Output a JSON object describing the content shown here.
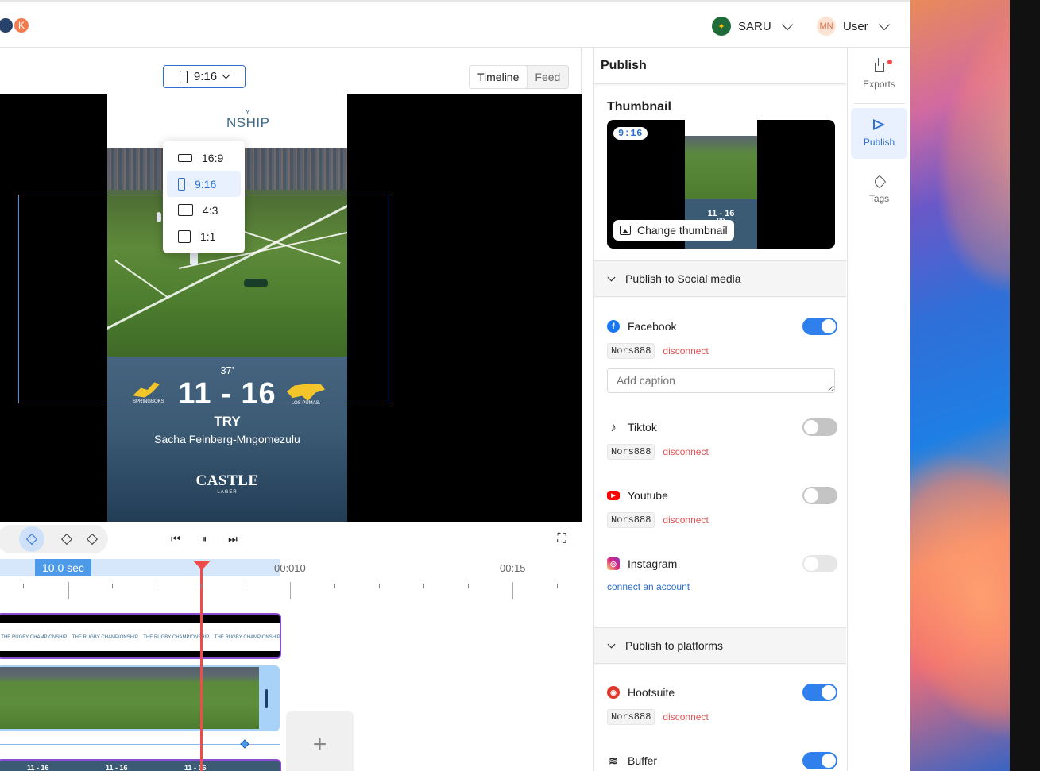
{
  "topbar": {
    "avatars": [
      "",
      "K"
    ],
    "org": {
      "name": "SARU"
    },
    "user": {
      "initials": "MN",
      "name": "User"
    }
  },
  "editor": {
    "ratio_button": {
      "label": "9:16"
    },
    "view_tabs": [
      "Timeline",
      "Feed"
    ],
    "active_view": "Timeline",
    "ratio_menu": [
      {
        "label": "16:9"
      },
      {
        "label": "9:16",
        "selected": true
      },
      {
        "label": "4:3"
      },
      {
        "label": "1:1"
      }
    ],
    "video": {
      "minute": "37’",
      "score": "11 - 16",
      "event": "TRY",
      "player": "Sacha Feinberg-Mngomezulu",
      "sponsor": "CASTLE",
      "sponsor_sub": "LAGER",
      "team_left": "SPRINGBOKS",
      "team_right": "LOS PUMAS.",
      "header_title": "NSHIP",
      "header_small": "Y"
    }
  },
  "timeline": {
    "duration_label": "10.0 sec",
    "tick_labels": [
      "00:010",
      "00:15"
    ],
    "track1_labels": [
      "THE RUGBY CHAMPIONSHIP",
      "THE RUGBY CHAMPIONSHIP",
      "THE RUGBY CHAMPIONSHIP",
      "THE RUGBY CHAMPIONSHIP"
    ],
    "track3_labels": [
      "11 - 16",
      "11 - 16",
      "11 - 16"
    ],
    "add_label": "+"
  },
  "publish": {
    "title": "Publish",
    "thumbnail": {
      "title": "Thumbnail",
      "ratio": "9:16",
      "change_label": "Change thumbnail",
      "mini_score": "11 - 16",
      "mini_event": "TRY"
    },
    "social_section": "Publish to Social media",
    "platforms_section": "Publish to platforms",
    "caption_placeholder": "Add caption",
    "disconnect_label": "disconnect",
    "connect_label": "connect an account",
    "social": [
      {
        "name": "Facebook",
        "account": "Nors888",
        "enabled": true,
        "color": "#1877f2"
      },
      {
        "name": "Tiktok",
        "account": "Nors888",
        "enabled": false,
        "color": "#000000"
      },
      {
        "name": "Youtube",
        "account": "Nors888",
        "enabled": false,
        "color": "#ff0000"
      },
      {
        "name": "Instagram",
        "account": "",
        "enabled": false,
        "color": "#d62976"
      }
    ],
    "platforms": [
      {
        "name": "Hootsuite",
        "account": "Nors888",
        "enabled": true,
        "color": "#e4352b"
      },
      {
        "name": "Buffer",
        "account": "",
        "enabled": true,
        "color": "#222222"
      }
    ]
  },
  "rail": {
    "items": [
      {
        "label": "Exports",
        "icon": "download-icon"
      },
      {
        "label": "Publish",
        "icon": "send-icon",
        "active": true
      },
      {
        "label": "Tags",
        "icon": "tag-icon"
      }
    ]
  },
  "colors": {
    "accent": "#2c6fd1",
    "toggle_on": "#2f80ed",
    "playhead": "#ef4b4b",
    "danger": "#e25555"
  }
}
